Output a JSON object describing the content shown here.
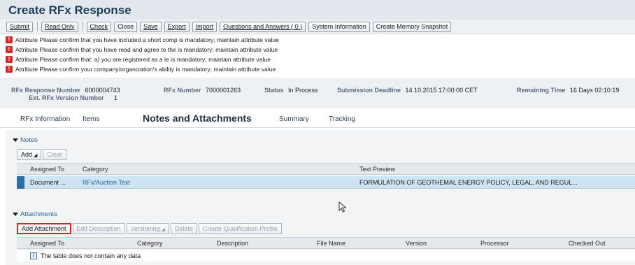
{
  "page": {
    "title": "Create RFx Response"
  },
  "toolbar": {
    "buttons": [
      {
        "label": "Submit",
        "underline": true
      },
      {
        "label": "Read Only",
        "underline": true
      },
      {
        "label": "Check",
        "underline": true
      },
      {
        "label": "Close",
        "underline": false
      },
      {
        "label": "Save",
        "underline": true
      },
      {
        "label": "Export",
        "underline": true
      },
      {
        "label": "Import",
        "underline": true
      },
      {
        "label": "Questions and Answers ( 0 )",
        "underline": true
      },
      {
        "label": "System Information",
        "underline": false
      },
      {
        "label": "Create Memory Snapshot",
        "underline": false
      }
    ]
  },
  "messages": [
    "Attribute Please confirm that you have included a short comp is mandatory; maintain attribute value",
    "Attribute Please confirm that you have read and agree to the is mandatory; maintain attribute value",
    "Attribute Please confirm that: a) you are registered as a le is mandatory; maintain attribute value",
    "Attribute Please confirm your company/organization's ability is mandatory; maintain attribute value"
  ],
  "header": {
    "response_number_label": "RFx Response Number",
    "response_number": "6000004743",
    "ext_version_label": "Ext. RFx Version Number",
    "ext_version": "1",
    "rfx_number_label": "RFx Number",
    "rfx_number": "7000001263",
    "status_label": "Status",
    "status": "In Process",
    "deadline_label": "Submission Deadline",
    "deadline": "14.10.2015 17:00:00 CET",
    "remaining_label": "Remaining Time",
    "remaining": "16 Days 02:10:19"
  },
  "tabs": [
    {
      "label": "RFx Information",
      "active": false
    },
    {
      "label": "Items",
      "active": false
    },
    {
      "label": "Notes and Attachments",
      "active": true
    },
    {
      "label": "Summary",
      "active": false
    },
    {
      "label": "Tracking",
      "active": false
    }
  ],
  "notes": {
    "title": "Notes",
    "add_label": "Add",
    "clear_label": "Clear",
    "columns": [
      "Assigned To",
      "Category",
      "Text Preview"
    ],
    "rows": [
      {
        "assigned_to": "Document ...",
        "category": "RFx/Auction Text",
        "text_preview": "FORMULATION OF GEOTHEMAL ENERGY POLICY, LEGAL, AND REGUL..."
      }
    ]
  },
  "attachments": {
    "title": "Attachments",
    "buttons": {
      "add": "Add Attachment",
      "edit": "Edit Description",
      "versioning": "Versioning",
      "delete": "Delete",
      "qualification": "Create Qualification Profile"
    },
    "columns": [
      "Assigned To",
      "Category",
      "Description",
      "File Name",
      "Version",
      "Processor",
      "Checked Out"
    ],
    "empty_text": "The table does not contain any data"
  },
  "colors": {
    "accent": "#2f6fa8",
    "error": "#d32b2b",
    "highlight": "#e02020"
  }
}
